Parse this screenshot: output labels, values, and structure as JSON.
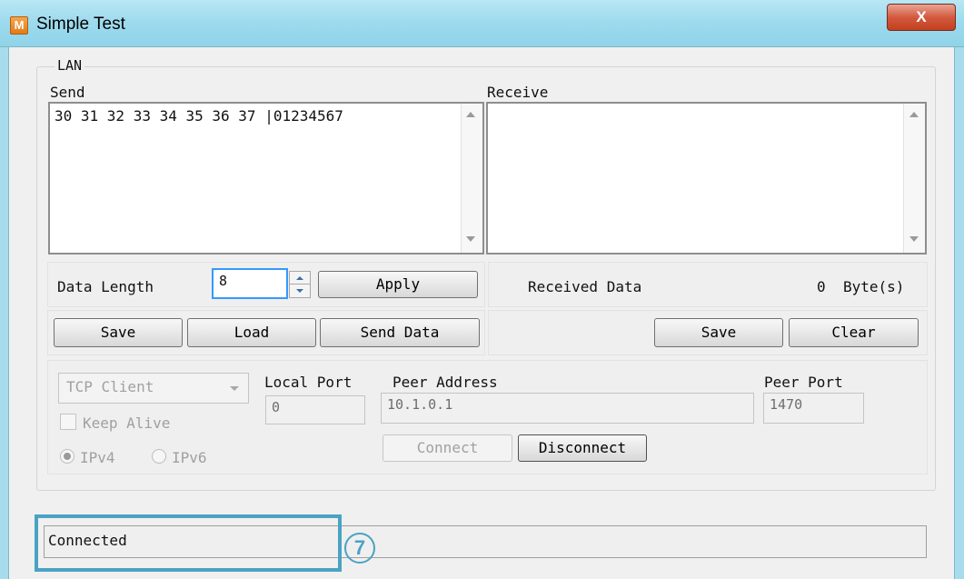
{
  "window": {
    "icon_letter": "M",
    "title": "Simple Test",
    "close_glyph": "X"
  },
  "lan": {
    "group_label": "LAN",
    "send_label": "Send",
    "send_content": "30 31 32 33 34 35 36 37 |01234567",
    "receive_label": "Receive",
    "receive_content": "",
    "data_length_label": "Data Length",
    "data_length_value": "8",
    "apply_label": "Apply",
    "received_data_label": "Received Data",
    "received_count": "0",
    "received_unit": "Byte(s)",
    "send_buttons": {
      "save": "Save",
      "load": "Load",
      "send_data": "Send Data"
    },
    "receive_buttons": {
      "save": "Save",
      "clear": "Clear"
    }
  },
  "connection": {
    "mode": "TCP Client",
    "keep_alive_label": "Keep Alive",
    "keep_alive_checked": false,
    "ipv4_label": "IPv4",
    "ipv6_label": "IPv6",
    "ip_version_selected": "IPv4",
    "local_port_label": "Local Port",
    "local_port_value": "0",
    "peer_address_label": "Peer Address",
    "peer_address_value": "10.1.0.1",
    "peer_port_label": "Peer Port",
    "peer_port_value": "1470",
    "connect_label": "Connect",
    "disconnect_label": "Disconnect"
  },
  "status": {
    "text": "Connected"
  },
  "annotation": {
    "callout_number": "7",
    "callout_glyph": "⑦",
    "color": "#4aa3c3"
  },
  "icons": [
    "scroll-up-arrow-icon",
    "scroll-down-arrow-icon",
    "spinner-up-icon",
    "spinner-down-icon",
    "combo-dropdown-icon",
    "close-icon",
    "app-icon"
  ]
}
